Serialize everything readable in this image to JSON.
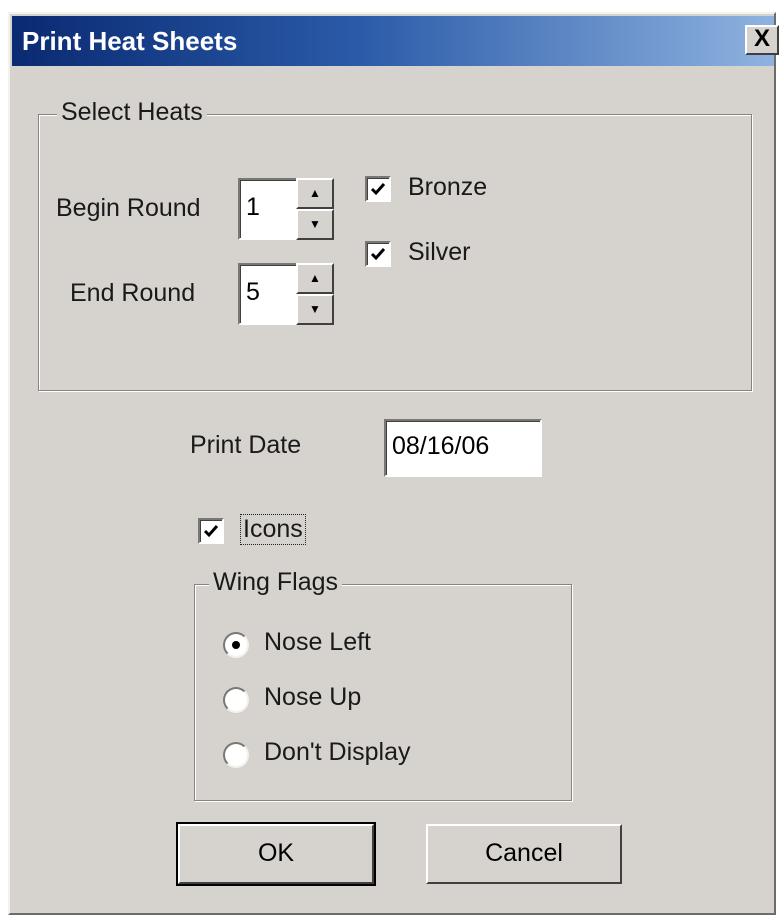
{
  "window": {
    "title": "Print Heat Sheets",
    "close_label": "X"
  },
  "select_heats": {
    "legend": "Select Heats",
    "begin_round": {
      "label": "Begin Round",
      "value": "1"
    },
    "end_round": {
      "label": "End Round",
      "value": "5"
    },
    "bronze": {
      "label": "Bronze",
      "checked": true
    },
    "silver": {
      "label": "Silver",
      "checked": true
    }
  },
  "print_date": {
    "label": "Print Date",
    "value": "08/16/06"
  },
  "icons": {
    "label": "Icons",
    "checked": true
  },
  "wing_flags": {
    "legend": "Wing Flags",
    "options": [
      {
        "label": "Nose Left",
        "selected": true
      },
      {
        "label": "Nose Up",
        "selected": false
      },
      {
        "label": "Don't Display",
        "selected": false
      }
    ]
  },
  "buttons": {
    "ok": "OK",
    "cancel": "Cancel"
  },
  "colors": {
    "dialog_face": "#d6d3ce",
    "titlebar_start": "#0a2a72",
    "titlebar_end": "#8fb3e0"
  }
}
